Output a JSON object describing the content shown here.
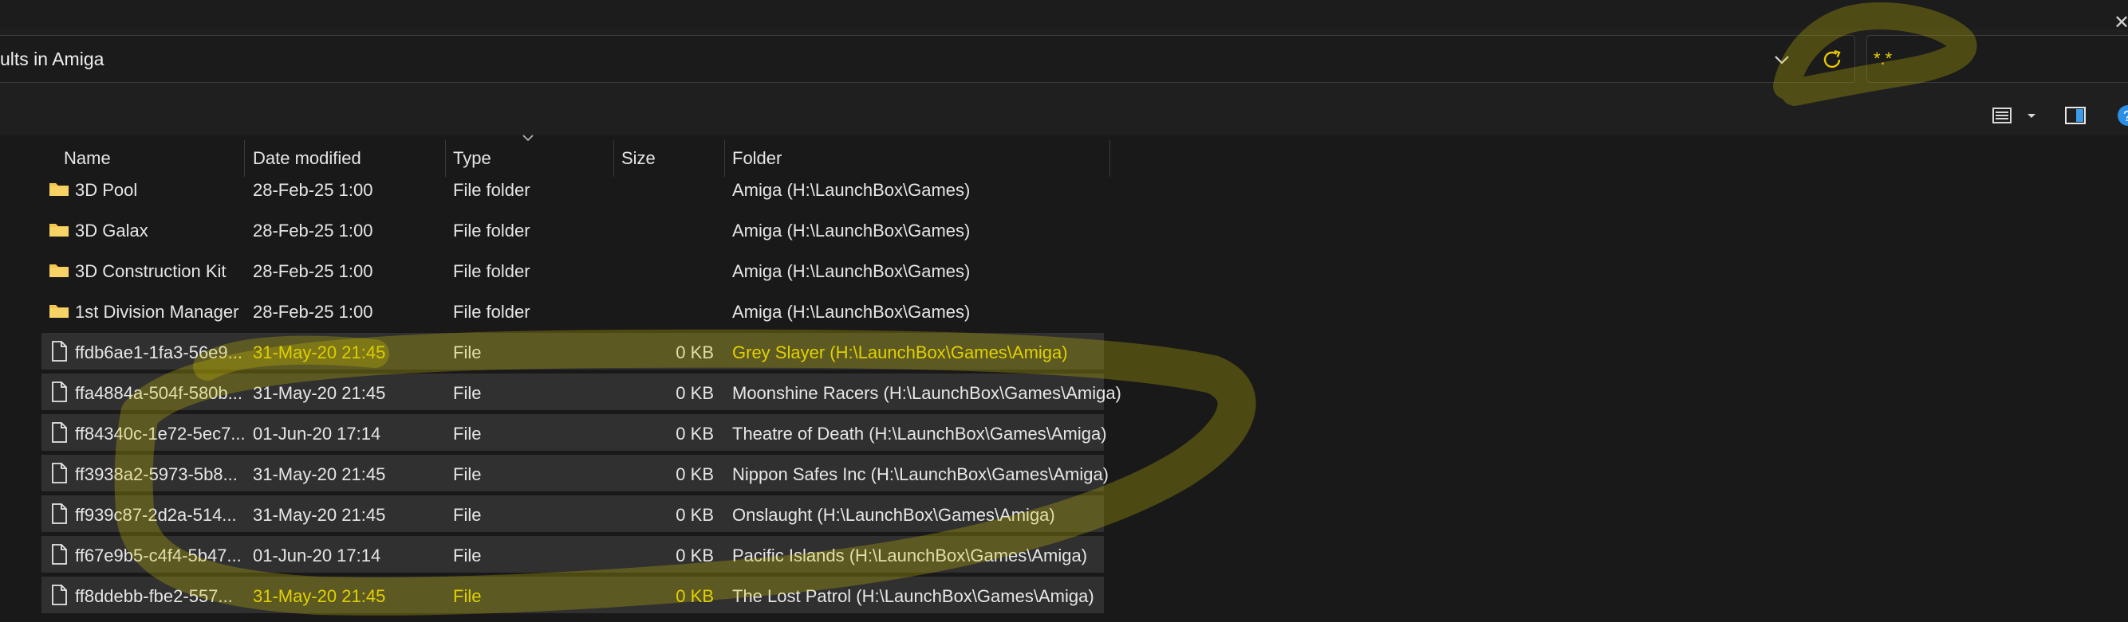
{
  "address": {
    "text": "ults in Amiga"
  },
  "search": {
    "value": "*.*"
  },
  "icons": {
    "dropdown": "chevron-down-icon",
    "refresh": "refresh-icon",
    "clear": "close-icon",
    "view": "details-view-icon",
    "view_dropdown": "caret-down-icon",
    "pane": "details-pane-icon",
    "help": "help-icon",
    "folder": "folder-icon",
    "file": "file-icon"
  },
  "search_clear_label": "✕",
  "help_label": "?",
  "columns": {
    "name": "Name",
    "date": "Date modified",
    "type": "Type",
    "size": "Size",
    "folder": "Folder"
  },
  "rows": [
    {
      "kind": "folder",
      "name": "3D Pool",
      "date": "28-Feb-25 1:00",
      "type": "File folder",
      "size": "",
      "folder": "Amiga (H:\\LaunchBox\\Games)"
    },
    {
      "kind": "folder",
      "name": "3D Galax",
      "date": "28-Feb-25 1:00",
      "type": "File folder",
      "size": "",
      "folder": "Amiga (H:\\LaunchBox\\Games)"
    },
    {
      "kind": "folder",
      "name": "3D Construction Kit",
      "date": "28-Feb-25 1:00",
      "type": "File folder",
      "size": "",
      "folder": "Amiga (H:\\LaunchBox\\Games)"
    },
    {
      "kind": "folder",
      "name": "1st Division Manager",
      "date": "28-Feb-25 1:00",
      "type": "File folder",
      "size": "",
      "folder": "Amiga (H:\\LaunchBox\\Games)"
    },
    {
      "kind": "file",
      "name": "ffdb6ae1-1fa3-56e9...",
      "date": "31-May-20 21:45",
      "type": "File",
      "size": "0 KB",
      "folder": "Grey Slayer (H:\\LaunchBox\\Games\\Amiga)"
    },
    {
      "kind": "file",
      "name": "ffa4884a-504f-580b...",
      "date": "31-May-20 21:45",
      "type": "File",
      "size": "0 KB",
      "folder": "Moonshine Racers (H:\\LaunchBox\\Games\\Amiga)"
    },
    {
      "kind": "file",
      "name": "ff84340c-1e72-5ec7...",
      "date": "01-Jun-20 17:14",
      "type": "File",
      "size": "0 KB",
      "folder": "Theatre of Death (H:\\LaunchBox\\Games\\Amiga)"
    },
    {
      "kind": "file",
      "name": "ff3938a2-5973-5b8...",
      "date": "31-May-20 21:45",
      "type": "File",
      "size": "0 KB",
      "folder": "Nippon Safes Inc (H:\\LaunchBox\\Games\\Amiga)"
    },
    {
      "kind": "file",
      "name": "ff939c87-2d2a-514...",
      "date": "31-May-20 21:45",
      "type": "File",
      "size": "0 KB",
      "folder": "Onslaught (H:\\LaunchBox\\Games\\Amiga)"
    },
    {
      "kind": "file",
      "name": "ff67e9b5-c4f4-5b47...",
      "date": "01-Jun-20 17:14",
      "type": "File",
      "size": "0 KB",
      "folder": "Pacific Islands (H:\\LaunchBox\\Games\\Amiga)"
    },
    {
      "kind": "file",
      "name": "ff8ddebb-fbe2-557...",
      "date": "31-May-20 21:45",
      "type": "File",
      "size": "0 KB",
      "folder": "The Lost Patrol (H:\\LaunchBox\\Games\\Amiga)"
    }
  ],
  "colors": {
    "background": "#191919",
    "row_file": "#303030",
    "highlight": "#e6d600",
    "refresh": "#e8c600",
    "folder_icon": "#f3c64d"
  }
}
